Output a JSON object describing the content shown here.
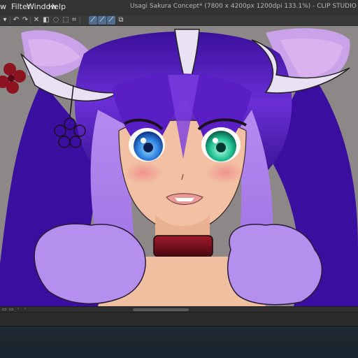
{
  "window": {
    "title": "Usagi Sakura Concept* (7800 x 4200px 1200dpi 133.1%) - CLIP STUDIO PAINT EX"
  },
  "menu": {
    "items": [
      {
        "label": "w",
        "name": "view"
      },
      {
        "label": "Filter",
        "name": "filter"
      },
      {
        "label": "Window",
        "name": "window"
      },
      {
        "label": "Help",
        "name": "help"
      }
    ]
  },
  "toolbar": {
    "icons": [
      "zoom-icon",
      "undo-icon",
      "redo-icon",
      "clear-icon",
      "fill-icon",
      "lasso-icon",
      "transform-icon",
      "crop-icon",
      "ruler-snap-icon",
      "special-ruler-snap-icon",
      "grid-snap-icon",
      "reference-icon"
    ]
  },
  "colors": {
    "accent": "#4e6f91",
    "canvas_bg": "#8c8888",
    "hair_main": "#5a1fc4",
    "hair_light": "#a67be6",
    "skin": "#f2c1a3",
    "eye_left": "#2e7fe0",
    "eye_right": "#1fbf8f",
    "choker": "#6a0d1a",
    "fur": "#b58fee",
    "flower": "#8c1320"
  }
}
